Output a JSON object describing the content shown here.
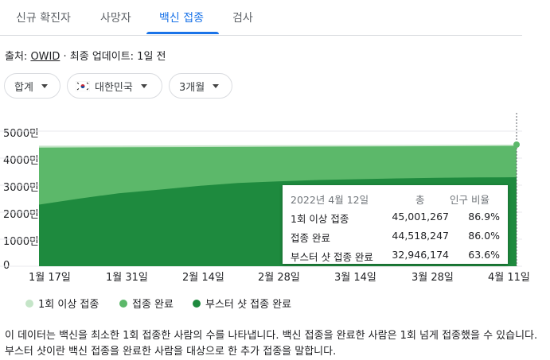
{
  "tabs": [
    {
      "label": "신규 확진자"
    },
    {
      "label": "사망자"
    },
    {
      "label": "백신 접종"
    },
    {
      "label": "검사"
    }
  ],
  "active_tab": "백신 접종",
  "source": {
    "prefix": "출처: ",
    "name": "OWID",
    "suffix": " · 최종 업데이트: 1일 전"
  },
  "filters": {
    "aggregate": "합계",
    "country": "대한민국",
    "range": "3개월"
  },
  "icons": {
    "flag": "south-korea-flag-icon",
    "dropdown": "caret-down-icon"
  },
  "colors": {
    "accent": "#1a73e8",
    "dose1": "#c5e5c8",
    "complete": "#5cb86a",
    "booster": "#1e8a3e"
  },
  "chart_data": {
    "type": "area",
    "y_ticks": [
      "5000만",
      "4000만",
      "3000만",
      "2000만",
      "1000만",
      "0"
    ],
    "x_ticks": [
      "1월 17일",
      "1월 31일",
      "2월 14일",
      "2월 28일",
      "3월 14일",
      "3월 28일",
      "4월 11일"
    ],
    "ylim": [
      0,
      50000000
    ],
    "series": [
      {
        "name": "1회 이상 접종",
        "x": [
          "1월 17일",
          "4월 12일"
        ],
        "values": [
          44600000,
          45001267
        ]
      },
      {
        "name": "접종 완료",
        "x": [
          "1월 17일",
          "4월 12일"
        ],
        "values": [
          43900000,
          44518247
        ]
      },
      {
        "name": "부스터 샷 접종 완료",
        "x": [
          "1월 17일",
          "1월 24일",
          "1월 31일",
          "2월 7일",
          "2월 14일",
          "2월 21일",
          "2월 28일",
          "3월 7일",
          "3월 14일",
          "3월 21일",
          "3월 28일",
          "4월 4일",
          "4월 12일"
        ],
        "values": [
          22800000,
          25000000,
          27000000,
          28300000,
          29700000,
          30800000,
          31400000,
          31900000,
          32200000,
          32500000,
          32700000,
          32850000,
          32946174
        ]
      }
    ],
    "tooltip": {
      "date": "2022년 4월 12일",
      "col_total": "총",
      "col_ratio": "인구 비율",
      "rows": [
        {
          "label": "1회 이상 접종",
          "total": "45,001,267",
          "ratio": "86.9%"
        },
        {
          "label": "접종 완료",
          "total": "44,518,247",
          "ratio": "86.0%"
        },
        {
          "label": "부스터 샷 접종 완료",
          "total": "32,946,174",
          "ratio": "63.6%"
        }
      ]
    },
    "legend": [
      "1회 이상 접종",
      "접종 완료",
      "부스터 샷 접종 완료"
    ]
  },
  "description": "이 데이터는 백신을 최소한 1회 접종한 사람의 수를 나타냅니다. 백신 접종을 완료한 사람은 1회 넘게 접종했을 수 있습니다. 부스터 샷이란 백신 접종을 완료한 사람을 대상으로 한 추가 접종을 말합니다."
}
